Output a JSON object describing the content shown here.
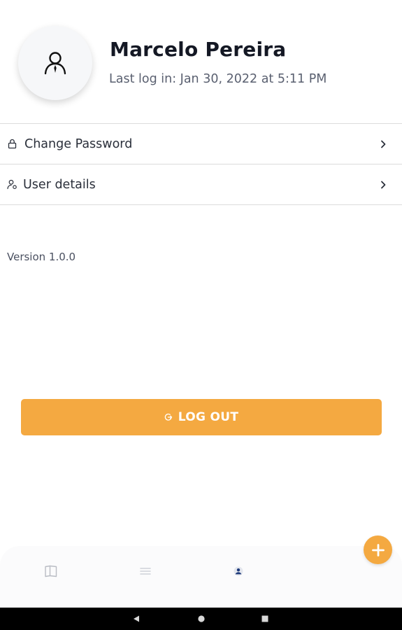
{
  "profile": {
    "name": "Marcelo Pereira",
    "last_login": "Last log in: Jan 30, 2022 at 5:11 PM"
  },
  "menu": {
    "items": [
      {
        "label": "Change Password",
        "icon": "lock-icon"
      },
      {
        "label": "User details",
        "icon": "user-settings-icon"
      }
    ]
  },
  "version": "Version 1.0.0",
  "logout": {
    "label": "LOG OUT",
    "icon": "logout-icon"
  },
  "bottom_nav": {
    "items": [
      {
        "icon": "book-icon",
        "active": false
      },
      {
        "icon": "list-icon",
        "active": false
      },
      {
        "icon": "profile-icon",
        "active": true
      }
    ],
    "fab_icon": "plus-icon"
  },
  "system_nav": [
    "back-icon",
    "home-icon",
    "recents-icon"
  ],
  "colors": {
    "accent": "#f4a941",
    "text_primary": "#141824",
    "text_secondary": "#5a6070",
    "divider": "#dcdcdc",
    "nav_active": "#1e3a7a"
  }
}
